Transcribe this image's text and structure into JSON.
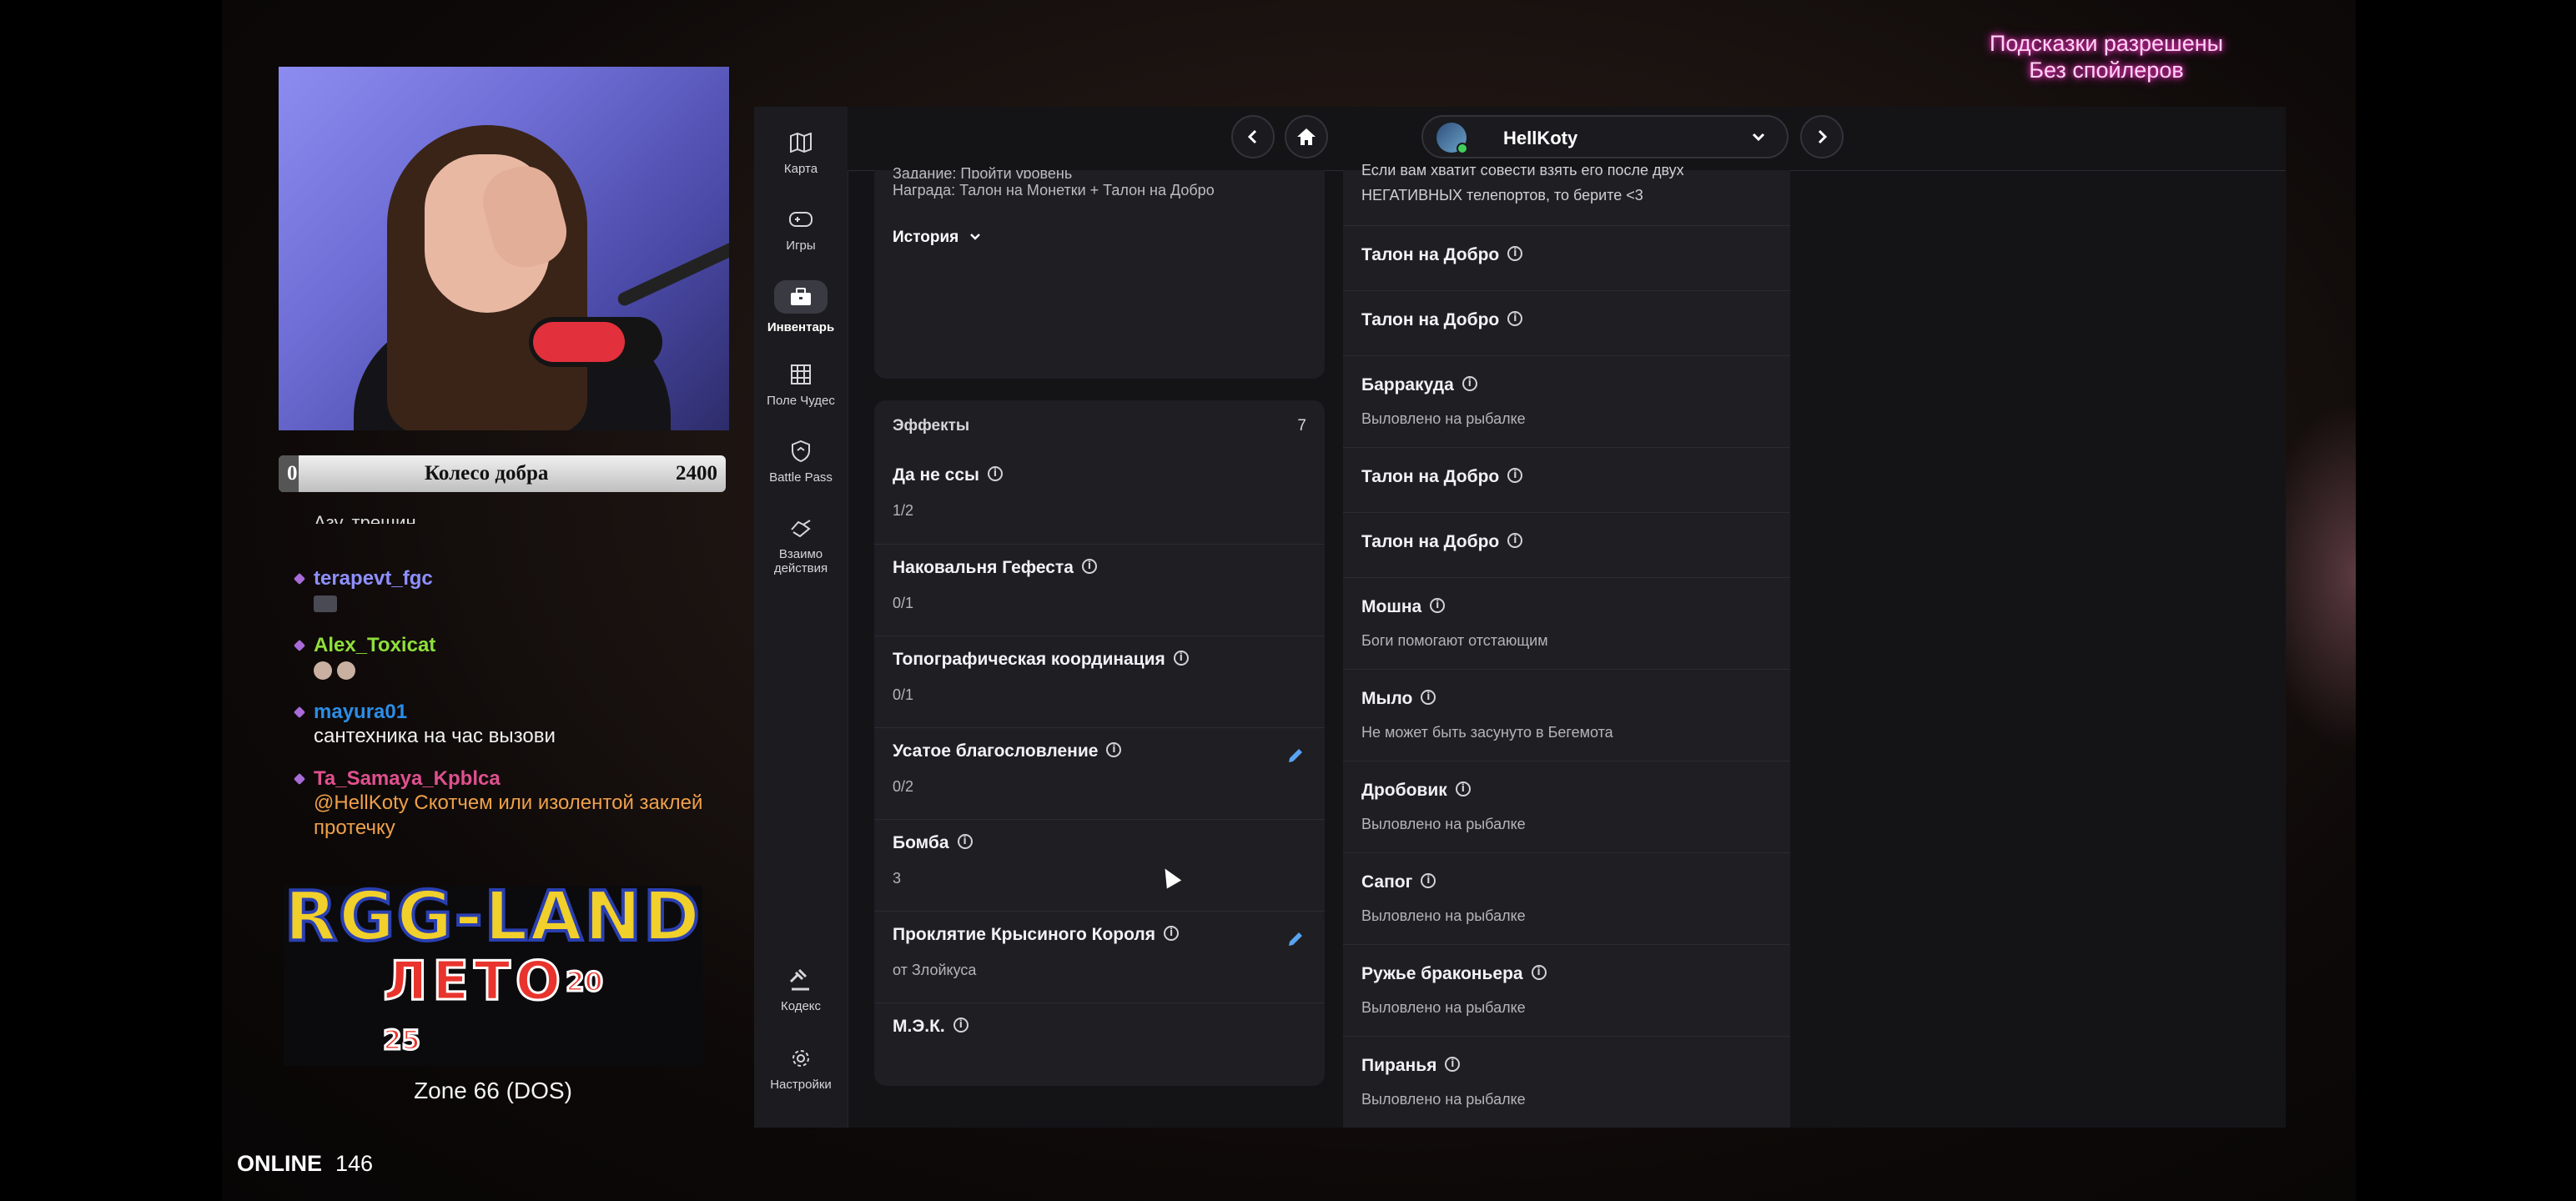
{
  "stream": {
    "wheel": {
      "left": "0",
      "title": "Колесо добра",
      "right": "2400"
    },
    "hints": {
      "line1": "Подсказки разрешены",
      "line2": "Без спойлеров"
    },
    "chat": {
      "cut_text": "Азу. трещин",
      "messages": [
        {
          "user": "terapevt_fgc",
          "color": "#8f8fff",
          "text": ""
        },
        {
          "user": "Alex_Toxicat",
          "color": "#8ee03a",
          "text": ""
        },
        {
          "user": "mayura01",
          "color": "#2c8de6",
          "text": "сантехника на час вызови"
        },
        {
          "user": "Ta_Samaya_Kpblca",
          "color": "#e0508f",
          "text": "@HellKoty  Скотчем или изолентой заклей протечку"
        }
      ]
    },
    "logo": {
      "line1": "RGG-LAND",
      "line2": "ЛЕТО",
      "year_top": "20",
      "year_bottom": "25"
    },
    "zone": "Zone 66 (DOS)",
    "online": {
      "label": "ONLINE",
      "count": "146"
    }
  },
  "app": {
    "sidebar": [
      {
        "label": "Карта",
        "icon": "map-icon"
      },
      {
        "label": "Игры",
        "icon": "gamepad-icon"
      },
      {
        "label": "Инвентарь",
        "icon": "briefcase-icon",
        "active": true
      },
      {
        "label": "Поле Чудес",
        "icon": "grid-icon"
      },
      {
        "label": "Battle Pass",
        "icon": "shield-icon"
      },
      {
        "label": "Взаимо действия",
        "icon": "handshake-icon"
      },
      {
        "label": "Кодекс",
        "icon": "gavel-icon"
      },
      {
        "label": "Настройки",
        "icon": "gear-icon"
      }
    ],
    "user": {
      "name": "HellKoty"
    },
    "quest_card": {
      "cut_line": "Задание: Пройти уровень",
      "reward": "Награда: Талон на Монетки + Талон на Добро",
      "history": "История"
    },
    "effects": {
      "title": "Эффекты",
      "count": "7",
      "items": [
        {
          "name": "Да не ссы",
          "sub": "1/2",
          "editable": false
        },
        {
          "name": "Наковальня Гефеста",
          "sub": "0/1",
          "editable": false
        },
        {
          "name": "Топографическая координация",
          "sub": "0/1",
          "editable": false
        },
        {
          "name": "Усатое благословление",
          "sub": "0/2",
          "editable": true
        },
        {
          "name": "Бомба",
          "sub": "3",
          "editable": false
        },
        {
          "name": "Проклятие Крысиного Короля",
          "sub": "от Злойкуса",
          "editable": true
        },
        {
          "name": "М.Э.К.",
          "sub": "",
          "editable": false
        }
      ]
    },
    "inventory": {
      "top_text_1": "Если вам хватит совести взять его после двух",
      "top_text_2": "НЕГАТИВНЫХ телепортов, то берите <3",
      "items": [
        {
          "name": "Талон на Добро",
          "sub": ""
        },
        {
          "name": "Талон на Добро",
          "sub": ""
        },
        {
          "name": "Барракуда",
          "sub": "Выловлено на рыбалке"
        },
        {
          "name": "Талон на Добро",
          "sub": ""
        },
        {
          "name": "Талон на Добро",
          "sub": ""
        },
        {
          "name": "Мошна",
          "sub": "Боги помогают отстающим"
        },
        {
          "name": "Мыло",
          "sub": "Не может быть засунуто в Бегемота"
        },
        {
          "name": "Дробовик",
          "sub": "Выловлено на рыбалке"
        },
        {
          "name": "Сапог",
          "sub": "Выловлено на рыбалке"
        },
        {
          "name": "Ружье браконьера",
          "sub": "Выловлено на рыбалке"
        },
        {
          "name": "Пиранья",
          "sub": "Выловлено на рыбалке"
        }
      ]
    }
  }
}
